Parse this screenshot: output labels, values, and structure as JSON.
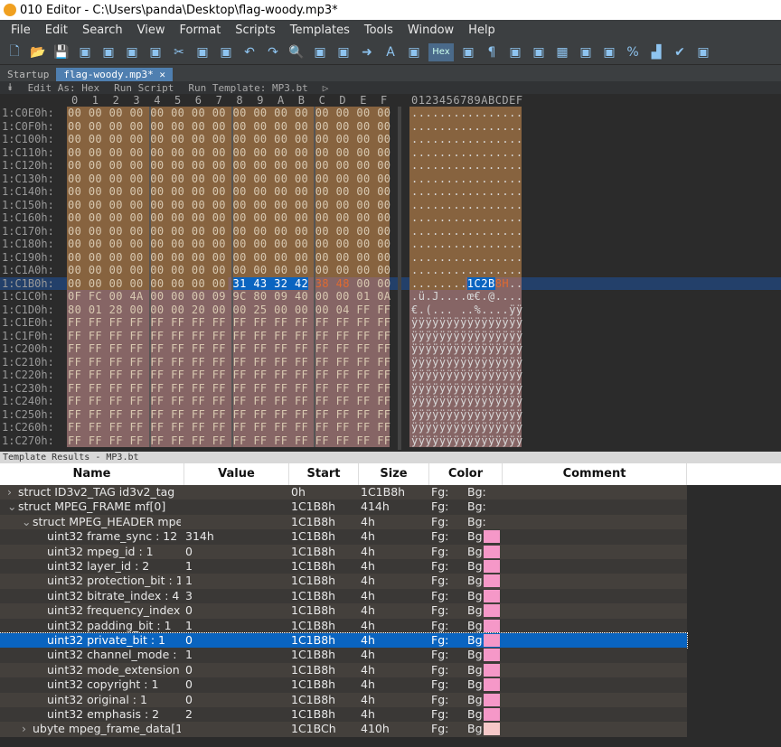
{
  "window": {
    "title": "010 Editor - C:\\Users\\panda\\Desktop\\flag-woody.mp3*"
  },
  "menu": [
    "File",
    "Edit",
    "Search",
    "View",
    "Format",
    "Scripts",
    "Templates",
    "Tools",
    "Window",
    "Help"
  ],
  "toolbar": {
    "hex_label": "Hex",
    "icons": [
      "new-file-icon",
      "open-icon",
      "save-icon",
      "save-as-icon",
      "save-all-icon",
      "open-folder-icon",
      "folders-icon",
      "cut-icon",
      "copy-icon",
      "paste-icon",
      "undo-icon",
      "redo-icon",
      "find-icon",
      "replace-icon",
      "find-in-files-icon",
      "goto-icon",
      "font-icon",
      "highlight-icon",
      "hex-icon",
      "columns-icon",
      "pilcrow-icon",
      "split-icon",
      "binary-icon",
      "calculator-icon",
      "clipboard-icon",
      "compare-icon",
      "percent-icon",
      "histogram-icon",
      "checksum-icon",
      "convert-icon"
    ]
  },
  "tabs": [
    {
      "label": "Startup",
      "active": false
    },
    {
      "label": "flag-woody.mp3*",
      "active": true
    }
  ],
  "editbar": {
    "edit_as": "Edit As: Hex",
    "run_script": "Run Script",
    "run_template": "Run Template: MP3.bt"
  },
  "hex": {
    "column_header": [
      "0",
      "1",
      "2",
      "3",
      "4",
      "5",
      "6",
      "7",
      "8",
      "9",
      "A",
      "B",
      "C",
      "D",
      "E",
      "F"
    ],
    "ascii_header": "0123456789ABCDEF",
    "colors": {
      "brown": "#87633f",
      "rose": "#866565",
      "selection": "#0a64c0",
      "orange": "#e06a30",
      "row_highlight": "#23406a"
    },
    "rows": [
      {
        "addr": "1:C0E0h:",
        "bytes": "00 00 00 00 00 00 00 00 00 00 00 00 00 00 00 00",
        "ascii": "................"
      },
      {
        "addr": "1:C0F0h:",
        "bytes": "00 00 00 00 00 00 00 00 00 00 00 00 00 00 00 00",
        "ascii": "................"
      },
      {
        "addr": "1:C100h:",
        "bytes": "00 00 00 00 00 00 00 00 00 00 00 00 00 00 00 00",
        "ascii": "................"
      },
      {
        "addr": "1:C110h:",
        "bytes": "00 00 00 00 00 00 00 00 00 00 00 00 00 00 00 00",
        "ascii": "................"
      },
      {
        "addr": "1:C120h:",
        "bytes": "00 00 00 00 00 00 00 00 00 00 00 00 00 00 00 00",
        "ascii": "................"
      },
      {
        "addr": "1:C130h:",
        "bytes": "00 00 00 00 00 00 00 00 00 00 00 00 00 00 00 00",
        "ascii": "................"
      },
      {
        "addr": "1:C140h:",
        "bytes": "00 00 00 00 00 00 00 00 00 00 00 00 00 00 00 00",
        "ascii": "................"
      },
      {
        "addr": "1:C150h:",
        "bytes": "00 00 00 00 00 00 00 00 00 00 00 00 00 00 00 00",
        "ascii": "................"
      },
      {
        "addr": "1:C160h:",
        "bytes": "00 00 00 00 00 00 00 00 00 00 00 00 00 00 00 00",
        "ascii": "................"
      },
      {
        "addr": "1:C170h:",
        "bytes": "00 00 00 00 00 00 00 00 00 00 00 00 00 00 00 00",
        "ascii": "................"
      },
      {
        "addr": "1:C180h:",
        "bytes": "00 00 00 00 00 00 00 00 00 00 00 00 00 00 00 00",
        "ascii": "................"
      },
      {
        "addr": "1:C190h:",
        "bytes": "00 00 00 00 00 00 00 00 00 00 00 00 00 00 00 00",
        "ascii": "................"
      },
      {
        "addr": "1:C1A0h:",
        "bytes": "00 00 00 00 00 00 00 00 00 00 00 00 00 00 00 00",
        "ascii": "................"
      },
      {
        "addr": "1:C1B0h:",
        "bytes": "00 00 00 00 00 00 00 00 31 43 32 42 38 48 00 00",
        "ascii": "........1C2B8H.."
      },
      {
        "addr": "1:C1C0h:",
        "bytes": "0F FC 00 4A 00 00 00 09 9C 80 09 40 00 00 01 0A",
        "ascii": ".ü.J....œ€.@...."
      },
      {
        "addr": "1:C1D0h:",
        "bytes": "80 01 28 00 00 00 20 00 00 25 00 00 00 04 FF FF",
        "ascii": "€.(... ..%....ÿÿ"
      },
      {
        "addr": "1:C1E0h:",
        "bytes": "FF FF FF FF FF FF FF FF FF FF FF FF FF FF FF FF",
        "ascii": "ÿÿÿÿÿÿÿÿÿÿÿÿÿÿÿÿ"
      },
      {
        "addr": "1:C1F0h:",
        "bytes": "FF FF FF FF FF FF FF FF FF FF FF FF FF FF FF FF",
        "ascii": "ÿÿÿÿÿÿÿÿÿÿÿÿÿÿÿÿ"
      },
      {
        "addr": "1:C200h:",
        "bytes": "FF FF FF FF FF FF FF FF FF FF FF FF FF FF FF FF",
        "ascii": "ÿÿÿÿÿÿÿÿÿÿÿÿÿÿÿÿ"
      },
      {
        "addr": "1:C210h:",
        "bytes": "FF FF FF FF FF FF FF FF FF FF FF FF FF FF FF FF",
        "ascii": "ÿÿÿÿÿÿÿÿÿÿÿÿÿÿÿÿ"
      },
      {
        "addr": "1:C220h:",
        "bytes": "FF FF FF FF FF FF FF FF FF FF FF FF FF FF FF FF",
        "ascii": "ÿÿÿÿÿÿÿÿÿÿÿÿÿÿÿÿ"
      },
      {
        "addr": "1:C230h:",
        "bytes": "FF FF FF FF FF FF FF FF FF FF FF FF FF FF FF FF",
        "ascii": "ÿÿÿÿÿÿÿÿÿÿÿÿÿÿÿÿ"
      },
      {
        "addr": "1:C240h:",
        "bytes": "FF FF FF FF FF FF FF FF FF FF FF FF FF FF FF FF",
        "ascii": "ÿÿÿÿÿÿÿÿÿÿÿÿÿÿÿÿ"
      },
      {
        "addr": "1:C250h:",
        "bytes": "FF FF FF FF FF FF FF FF FF FF FF FF FF FF FF FF",
        "ascii": "ÿÿÿÿÿÿÿÿÿÿÿÿÿÿÿÿ"
      },
      {
        "addr": "1:C260h:",
        "bytes": "FF FF FF FF FF FF FF FF FF FF FF FF FF FF FF FF",
        "ascii": "ÿÿÿÿÿÿÿÿÿÿÿÿÿÿÿÿ"
      },
      {
        "addr": "1:C270h:",
        "bytes": "FF FF FF FF FF FF FF FF FF FF FF FF FF FF FF FF",
        "ascii": "ÿÿÿÿÿÿÿÿÿÿÿÿÿÿÿÿ"
      }
    ]
  },
  "results": {
    "title": "Template Results - MP3.bt",
    "columns": [
      "Name",
      "Value",
      "Start",
      "Size",
      "Color",
      "Comment"
    ],
    "rows": [
      {
        "name": "struct ID3v2_TAG id3v2_tag",
        "value": "",
        "start": "0h",
        "size": "1C1B8h",
        "fg": "Fg:",
        "bg": "Bg:",
        "level": 0,
        "toggle": "›",
        "swatch": ""
      },
      {
        "name": "struct MPEG_FRAME mf[0]",
        "value": "",
        "start": "1C1B8h",
        "size": "414h",
        "fg": "Fg:",
        "bg": "Bg:",
        "level": 0,
        "toggle": "⌄",
        "swatch": ""
      },
      {
        "name": "struct MPEG_HEADER mpeg...",
        "value": "",
        "start": "1C1B8h",
        "size": "4h",
        "fg": "Fg:",
        "bg": "Bg:",
        "level": 1,
        "toggle": "⌄",
        "swatch": ""
      },
      {
        "name": "uint32 frame_sync : 12",
        "value": "314h",
        "start": "1C1B8h",
        "size": "4h",
        "fg": "Fg:",
        "bg": "Bg:",
        "level": 2,
        "swatch": "#f598c8"
      },
      {
        "name": "uint32 mpeg_id : 1",
        "value": "0",
        "start": "1C1B8h",
        "size": "4h",
        "fg": "Fg:",
        "bg": "Bg:",
        "level": 2,
        "swatch": "#f598c8"
      },
      {
        "name": "uint32 layer_id : 2",
        "value": "1",
        "start": "1C1B8h",
        "size": "4h",
        "fg": "Fg:",
        "bg": "Bg:",
        "level": 2,
        "swatch": "#f598c8"
      },
      {
        "name": "uint32 protection_bit : 1",
        "value": "1",
        "start": "1C1B8h",
        "size": "4h",
        "fg": "Fg:",
        "bg": "Bg:",
        "level": 2,
        "swatch": "#f598c8"
      },
      {
        "name": "uint32 bitrate_index : 4",
        "value": "3",
        "start": "1C1B8h",
        "size": "4h",
        "fg": "Fg:",
        "bg": "Bg:",
        "level": 2,
        "swatch": "#f598c8"
      },
      {
        "name": "uint32 frequency_index : 2",
        "value": "0",
        "start": "1C1B8h",
        "size": "4h",
        "fg": "Fg:",
        "bg": "Bg:",
        "level": 2,
        "swatch": "#f598c8"
      },
      {
        "name": "uint32 padding_bit : 1",
        "value": "1",
        "start": "1C1B8h",
        "size": "4h",
        "fg": "Fg:",
        "bg": "Bg:",
        "level": 2,
        "swatch": "#f598c8"
      },
      {
        "name": "uint32 private_bit : 1",
        "value": "0",
        "start": "1C1B8h",
        "size": "4h",
        "fg": "Fg:",
        "bg": "Bg:",
        "level": 2,
        "swatch": "#f598c8",
        "selected": true
      },
      {
        "name": "uint32 channel_mode : 2",
        "value": "1",
        "start": "1C1B8h",
        "size": "4h",
        "fg": "Fg:",
        "bg": "Bg:",
        "level": 2,
        "swatch": "#f598c8"
      },
      {
        "name": "uint32 mode_extension : 2",
        "value": "0",
        "start": "1C1B8h",
        "size": "4h",
        "fg": "Fg:",
        "bg": "Bg:",
        "level": 2,
        "swatch": "#f598c8"
      },
      {
        "name": "uint32 copyright : 1",
        "value": "0",
        "start": "1C1B8h",
        "size": "4h",
        "fg": "Fg:",
        "bg": "Bg:",
        "level": 2,
        "swatch": "#f598c8"
      },
      {
        "name": "uint32 original : 1",
        "value": "0",
        "start": "1C1B8h",
        "size": "4h",
        "fg": "Fg:",
        "bg": "Bg:",
        "level": 2,
        "swatch": "#f598c8"
      },
      {
        "name": "uint32 emphasis : 2",
        "value": "2",
        "start": "1C1B8h",
        "size": "4h",
        "fg": "Fg:",
        "bg": "Bg:",
        "level": 2,
        "swatch": "#f598c8"
      },
      {
        "name": "ubyte mpeg_frame_data[10...",
        "value": "",
        "start": "1C1BCh",
        "size": "410h",
        "fg": "Fg:",
        "bg": "Bg:",
        "level": 1,
        "toggle": "›",
        "swatch": "#f5c8c8"
      }
    ]
  }
}
